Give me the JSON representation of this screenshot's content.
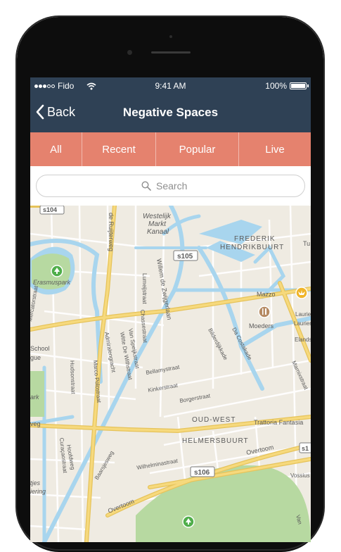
{
  "status_bar": {
    "carrier": "Fido",
    "time": "9:41 AM",
    "battery": "100%",
    "signal_bars": 3,
    "signal_total": 5
  },
  "nav": {
    "back_label": "Back",
    "title": "Negative Spaces"
  },
  "tabs": [
    {
      "label": "All",
      "active": true
    },
    {
      "label": "Recent",
      "active": false
    },
    {
      "label": "Popular",
      "active": false
    },
    {
      "label": "Live",
      "active": false
    }
  ],
  "search": {
    "placeholder": "Search"
  },
  "map": {
    "labels": {
      "westelijk": "Westelijk",
      "markt": "Markt",
      "kanaal": "Kanaal",
      "frederik": "FREDERIK",
      "hendrikbuurt": "HENDRIKBUURT",
      "s104": "s104",
      "s105": "s105",
      "s106": "s106",
      "ruijterweg": "de Ruijterweg",
      "zwijger": "Willem de Zwijgerlaan",
      "erasmuspark": "Erasmuspark",
      "mazzo": "Mazzo",
      "moeders": "Moeders",
      "mercatorstraat": "Mercatorstraat",
      "admiraal": "Admiralengracht",
      "witte": "Witte De Withstraat",
      "speijk": "Van Speijkstraat",
      "chasse": "Chassestraat",
      "lumey": "Lumeijstraat",
      "bilderdijk": "Bilderdijkkade",
      "dacosta": "Da Costakade",
      "marnix": "Marnixstraat",
      "school": "School",
      "gue": "gue",
      "ark": "ark",
      "marcopolo": "Marco Polostraat",
      "hudson": "Hudsonstraat",
      "bellamy": "Bellamystraat",
      "kinker": "Kinkerstraat",
      "borger": "Borgerstraat",
      "oudwest": "OUD-WEST",
      "trattoria": "Trattoria Fantasia",
      "helmers": "HELMERSBUURT",
      "overtoom": "Overtoom",
      "overtoom2": "Overtoom",
      "wilhelmina": "Wilhelminastraat",
      "hoofdweg": "Hoofdweg",
      "curacao": "Curaçaostraat",
      "baarsjes": "Baarsjesweg",
      "tjes": "tjes",
      "ring": "iering",
      "veg": "veg",
      "vossius": "Vossius",
      "tu": "Tu",
      "lau1": "Laurier",
      "lau2": "Laurier",
      "elands": "Elandst",
      "s1": "s1",
      "van": "Van"
    }
  },
  "colors": {
    "nav_bg": "#2f4155",
    "tab_bg": "#e5826e",
    "water": "#a8d5ee",
    "park": "#b7d9a1",
    "road_major": "#f6d97d"
  }
}
